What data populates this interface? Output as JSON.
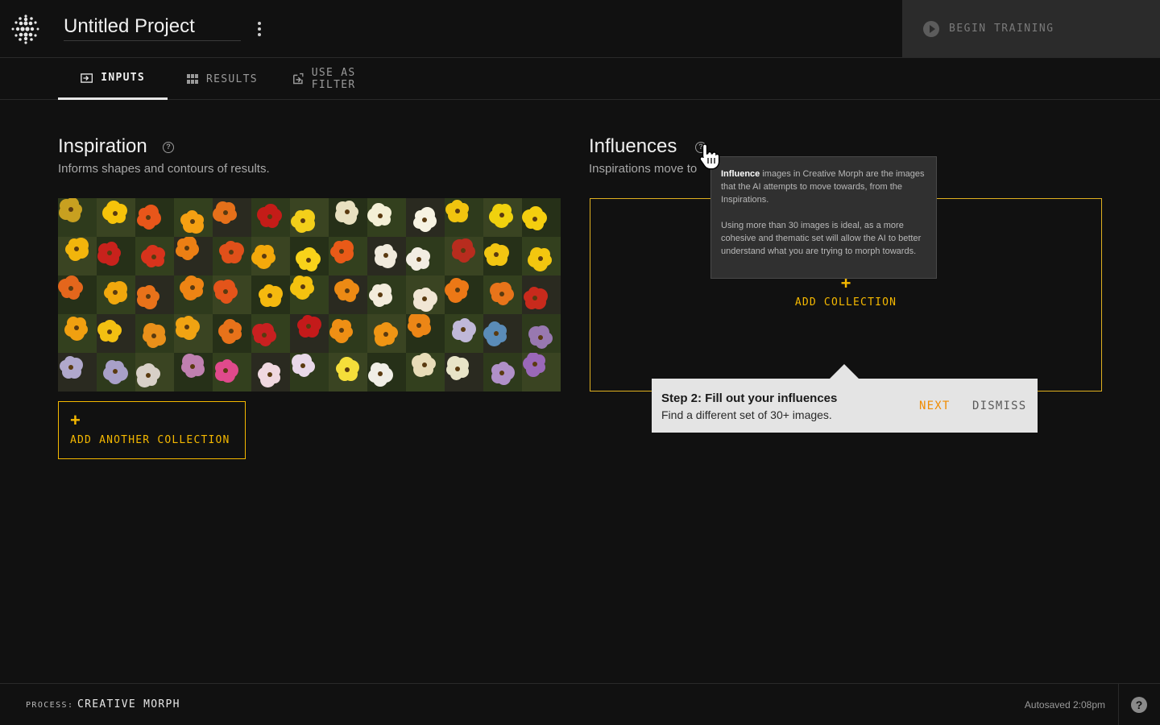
{
  "header": {
    "project_title": "Untitled Project",
    "train_button_label": "BEGIN TRAINING"
  },
  "tabs": [
    {
      "label": "INPUTS",
      "icon": "input-icon",
      "active": true
    },
    {
      "label": "RESULTS",
      "icon": "grid-icon",
      "active": false
    },
    {
      "label": "USE AS FILTER",
      "icon": "export-icon",
      "active": false
    }
  ],
  "inspiration": {
    "title": "Inspiration",
    "subtitle": "Informs shapes and contours of results.",
    "add_label": "ADD ANOTHER COLLECTION",
    "add_plus": "+",
    "thumb_palette": [
      [
        "#c8a020",
        "#f6c30a",
        "#e8561a",
        "#f5a012",
        "#e5701a",
        "#c41c18",
        "#f3cf1a",
        "#e8e0c0",
        "#f4f0d6",
        "#f7f3e2",
        "#f1c40f",
        "#f0d10e",
        "#f4ce0f"
      ],
      [
        "#f2b50c",
        "#c8221c",
        "#d8331c",
        "#ec7f14",
        "#e0501a",
        "#f3a90b",
        "#f8d21a",
        "#e95a18",
        "#f0eadc",
        "#f2ede2",
        "#b82c1e",
        "#f2c512",
        "#f3c60f"
      ],
      [
        "#e4661c",
        "#f1a80d",
        "#e9721a",
        "#ee8414",
        "#e4541a",
        "#f5b90f",
        "#f4c20f",
        "#ec8a14",
        "#f3ecdc",
        "#f1e6d4",
        "#ec7816",
        "#e8741a",
        "#c82a1c"
      ],
      [
        "#f0a010",
        "#f3c012",
        "#e9901a",
        "#f0a312",
        "#e8721a",
        "#c82020",
        "#c41a1a",
        "#ef8f14",
        "#ef9514",
        "#ec8616",
        "#c0b8d8",
        "#5a8cb8",
        "#9878b0"
      ],
      [
        "#b0a8cc",
        "#a8a0c8",
        "#d8d0c8",
        "#c080b0",
        "#e04a8c",
        "#f0d8e0",
        "#e8d8e8",
        "#f5de3a",
        "#f0eee6",
        "#e8dcb8",
        "#e8e4c8",
        "#b090c8",
        "#9a68b8"
      ]
    ]
  },
  "influences": {
    "title": "Influences",
    "subtitle": "Inspirations move to",
    "add_label": "ADD COLLECTION",
    "add_plus": "+"
  },
  "tooltip": {
    "bold": "Influence",
    "line1_rest": " images in Creative Morph are the images that the AI attempts to move towards, from the Inspirations.",
    "paragraph2": "Using more than 30 images is ideal, as a more cohesive and thematic set will allow the AI to better understand what you are trying to morph towards."
  },
  "tour": {
    "title": "Step 2: Fill out your influences",
    "body": "Find a different set of 30+ images.",
    "next_label": "NEXT",
    "dismiss_label": "DISMISS"
  },
  "footer": {
    "process_key": "PROCESS:",
    "process_value": "CREATIVE MORPH",
    "autosave": "Autosaved 2:08pm",
    "help_label": "?"
  },
  "colors": {
    "accent": "#f5b800",
    "next": "#f08c00",
    "background": "#111111"
  }
}
